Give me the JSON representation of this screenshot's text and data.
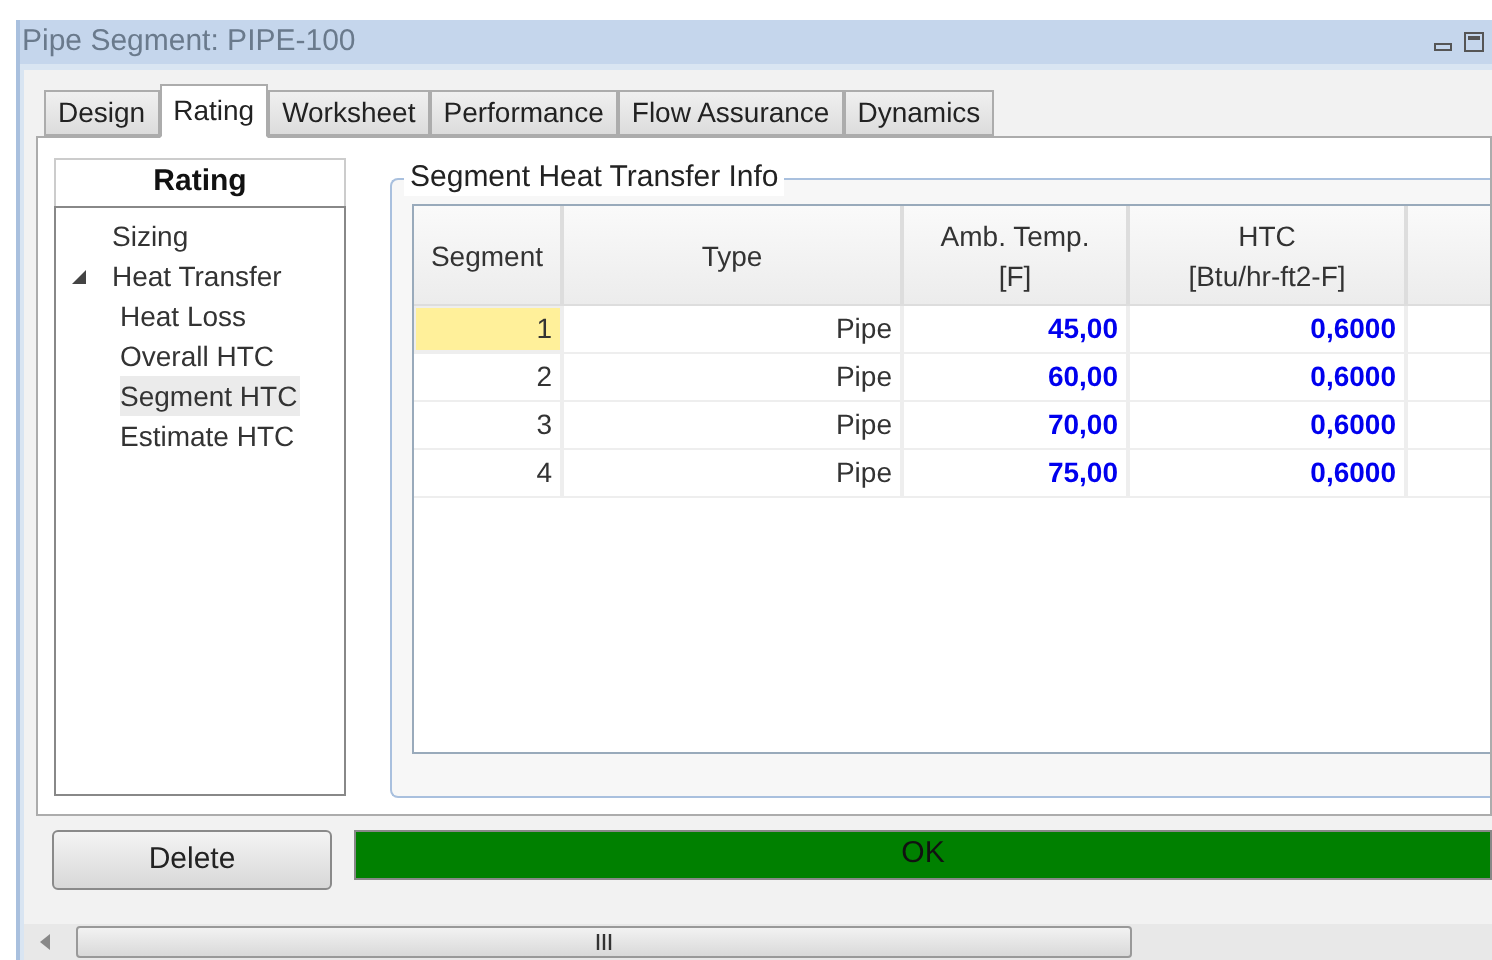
{
  "window": {
    "title": "Pipe Segment: PIPE-100"
  },
  "tabs": [
    {
      "label": "Design",
      "selected": false
    },
    {
      "label": "Rating",
      "selected": true
    },
    {
      "label": "Worksheet",
      "selected": false
    },
    {
      "label": "Performance",
      "selected": false
    },
    {
      "label": "Flow Assurance",
      "selected": false
    },
    {
      "label": "Dynamics",
      "selected": false
    }
  ],
  "sidebar": {
    "header": "Rating",
    "items": [
      {
        "label": "Sizing",
        "selected": false
      },
      {
        "label": "Heat Transfer",
        "expanded": true,
        "selected": false,
        "children": [
          {
            "label": "Heat Loss",
            "selected": false
          },
          {
            "label": "Overall HTC",
            "selected": false
          },
          {
            "label": "Segment HTC",
            "selected": true
          },
          {
            "label": "Estimate HTC",
            "selected": false
          }
        ]
      }
    ]
  },
  "group": {
    "title": "Segment Heat Transfer Info"
  },
  "table": {
    "columns": [
      "Segment",
      "Type",
      "Amb. Temp.\n[F]",
      "HTC\n[Btu/hr-ft2-F]"
    ],
    "rows": [
      {
        "cells": [
          "1",
          "Pipe",
          "45,00",
          "0,6000"
        ],
        "selected": true
      },
      {
        "cells": [
          "2",
          "Pipe",
          "60,00",
          "0,6000"
        ],
        "selected": false
      },
      {
        "cells": [
          "3",
          "Pipe",
          "70,00",
          "0,6000"
        ],
        "selected": false
      },
      {
        "cells": [
          "4",
          "Pipe",
          "75,00",
          "0,6000"
        ],
        "selected": false
      }
    ]
  },
  "delete_button": "Delete",
  "status": {
    "text": "OK",
    "color": "#008000"
  }
}
